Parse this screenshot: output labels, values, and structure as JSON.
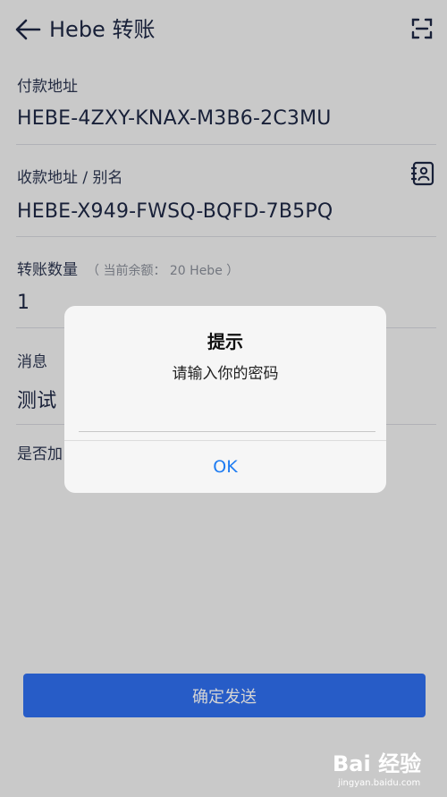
{
  "header": {
    "title": "Hebe 转账",
    "back_icon": "arrow-left-icon",
    "scan_icon": "scan-icon"
  },
  "form": {
    "payer": {
      "label": "付款地址",
      "value": "HEBE-4ZXY-KNAX-M3B6-2C3MU"
    },
    "payee": {
      "label": "收款地址 / 别名",
      "value": "HEBE-X949-FWSQ-BQFD-7B5PQ",
      "icon": "contacts-icon"
    },
    "amount": {
      "label": "转账数量",
      "hint": "（ 当前余额： 20 Hebe ）",
      "value": "1"
    },
    "message": {
      "label": "消息",
      "value": "测试"
    },
    "encrypt": {
      "label": "是否加"
    }
  },
  "confirm_button": {
    "label": "确定发送"
  },
  "dialog": {
    "title": "提示",
    "message": "请输入你的密码",
    "password_value": "",
    "ok_label": "OK"
  },
  "watermark": {
    "main": "Bai 经验",
    "sub": "jingyan.baidu.com"
  },
  "colors": {
    "primary": "#2f6ff0",
    "dialog_button": "#1e7cf2",
    "text": "#1d2744"
  }
}
